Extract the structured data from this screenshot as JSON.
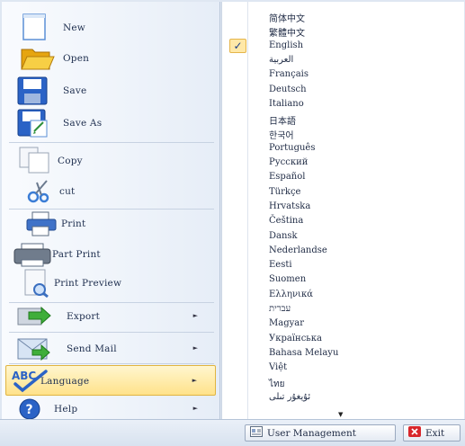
{
  "menu": {
    "new": "New",
    "open": "Open",
    "save": "Save",
    "save_as": "Save As",
    "copy": "Copy",
    "cut": "cut",
    "print": "Print",
    "part_print": "Part Print",
    "print_preview": "Print Preview",
    "export": "Export",
    "send_mail": "Send Mail",
    "language": "Language",
    "help": "Help",
    "submenu_arrow": "►"
  },
  "languages": {
    "selected": "English",
    "check_mark": "✓",
    "more_indicator": "▼",
    "items": [
      "简体中文",
      "繁體中文",
      "English",
      "العربية",
      "Français",
      "Deutsch",
      "Italiano",
      "日本語",
      "한국어",
      "Português",
      "Русский",
      "Español",
      "Türkçe",
      "Hrvatska",
      "Čeština",
      "Dansk",
      "Nederlandse",
      "Eesti",
      "Suomen",
      "Ελληνικά",
      "עברית",
      "Magyar",
      "Українська",
      "Bahasa Melayu",
      "Việt",
      "ไทย",
      "ئۇيغۇر تىلى"
    ]
  },
  "bottom_bar": {
    "user_management": "User Management",
    "exit": "Exit"
  },
  "colors": {
    "highlight": "#ffe28a",
    "highlight_border": "#e0b440",
    "accent_blue": "#2b63c6",
    "exit_red": "#d8262b"
  }
}
